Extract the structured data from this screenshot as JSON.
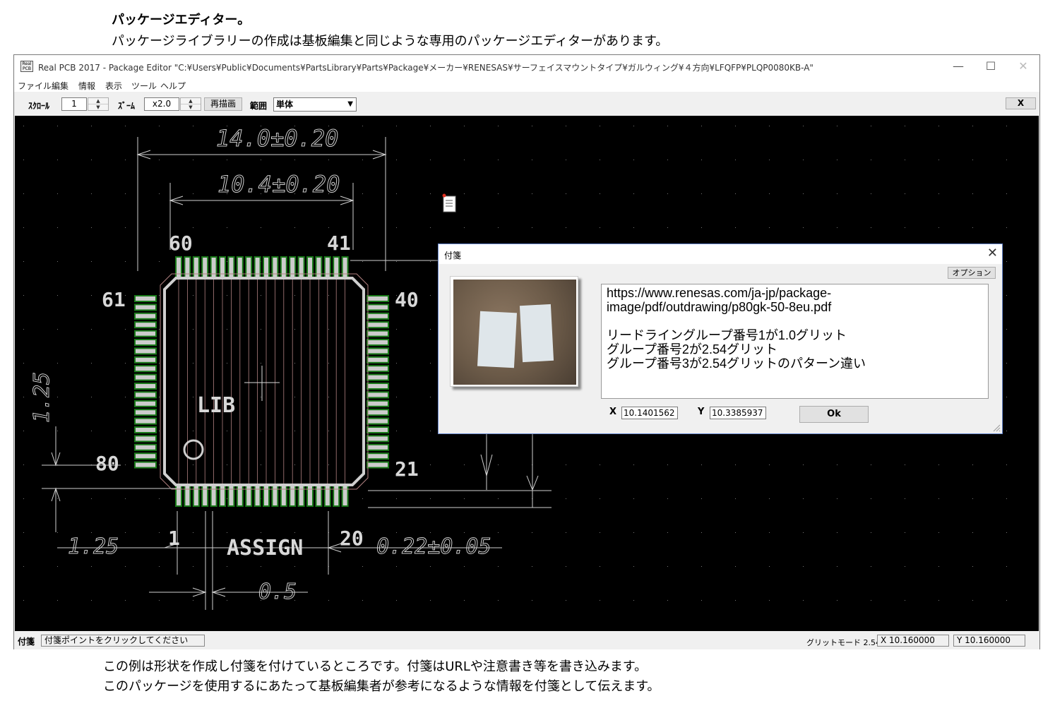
{
  "page": {
    "heading": "パッケージエディター。",
    "subheading": "パッケージライブラリーの作成は基板編集と同じような専用のパッケージエディターがあります。",
    "caption_line1": "この例は形状を作成し付箋を付けているところです。付箋はURLや注意書き等を書き込みます。",
    "caption_line2": "このパッケージを使用するにあたって基板編集者が参考になるような情報を付箋として伝えます。"
  },
  "window": {
    "title": "Real PCB 2017 - Package Editor \"C:¥Users¥Public¥Documents¥PartsLibrary¥Parts¥Package¥メーカー¥RENESAS¥サーフェイスマウントタイプ¥ガルウィング¥４方向¥LFQFP¥PLQP0080KB-A\"",
    "app_icon_text": "Real PCB",
    "controls": {
      "minimize": "—",
      "maximize": "☐",
      "close": "✕"
    }
  },
  "menu": [
    "ファイル",
    "編集",
    "情報",
    "表示",
    "ツール",
    "ヘルプ"
  ],
  "toolbar": {
    "scroll_label": "ｽｸﾛｰﾙ",
    "scroll_value": "1",
    "zoom_label": "ｽﾞｰﾑ",
    "zoom_value": "x2.0",
    "redraw_button": "再描画",
    "range_label": "範囲",
    "range_value": "単体",
    "close_button": "X"
  },
  "drawing": {
    "dim_top_outer": "14.0±0.20",
    "dim_top_inner": "10.4±0.20",
    "pin_labels": {
      "p60": "60",
      "p41": "41",
      "p61": "61",
      "p40": "40",
      "p80": "80",
      "p21": "21",
      "p1": "1",
      "p20": "20"
    },
    "lib_label": "LIB",
    "assign_label": "ASSIGN",
    "dim_left": "1.25",
    "dim_bottom_left": "1.25",
    "dim_lead_width": "0.22±0.05",
    "dim_pitch": "0.5",
    "colors": {
      "pad_green": "#1a7a1a",
      "outline": "#cfcfcf",
      "leadline": "#b08080"
    }
  },
  "status": {
    "label": "付箋",
    "message": "付箋ポイントをクリックしてください",
    "grid_mode": "グリットモード 2.54",
    "x": "X 10.160000",
    "y": "Y 10.160000"
  },
  "dialog": {
    "title": "付箋",
    "close": "✕",
    "option_button": "オプション",
    "lines": [
      "https://www.renesas.com/ja-jp/package-",
      "image/pdf/outdrawing/p80gk-50-8eu.pdf",
      "",
      "リードライングループ番号1が1.0グリット",
      "グループ番号2が2.54グリット",
      "グループ番号3が2.54グリットのパターン違い"
    ],
    "x_label": "X",
    "x_value": "10.1401562",
    "y_label": "Y",
    "y_value": "10.3385937",
    "ok_button": "Ok"
  }
}
